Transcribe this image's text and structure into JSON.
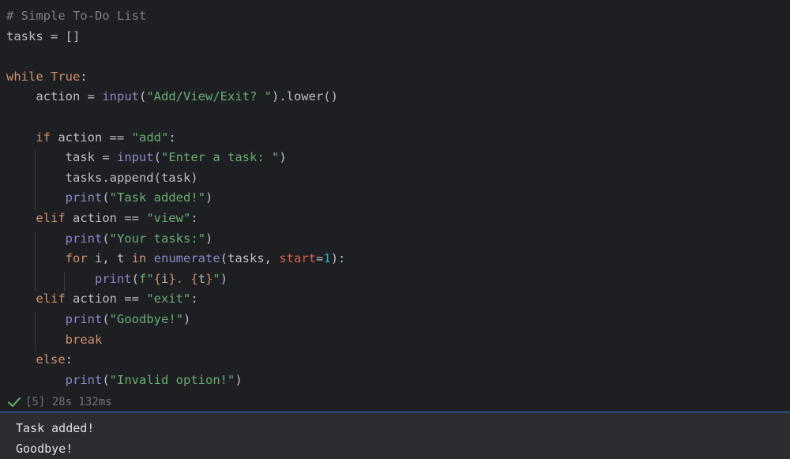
{
  "editor": {
    "lines": [
      [
        {
          "t": "# Simple To-Do List",
          "c": "comment"
        }
      ],
      [
        {
          "t": "tasks = []",
          "c": "plain"
        }
      ],
      [],
      [
        {
          "t": "while",
          "c": "kw"
        },
        {
          "t": " ",
          "c": "plain"
        },
        {
          "t": "True",
          "c": "kw"
        },
        {
          "t": ":",
          "c": "plain"
        }
      ],
      [
        {
          "t": "    action = ",
          "c": "plain"
        },
        {
          "t": "input",
          "c": "builtin"
        },
        {
          "t": "(",
          "c": "plain"
        },
        {
          "t": "\"Add/View/Exit? \"",
          "c": "str"
        },
        {
          "t": ").lower()",
          "c": "plain"
        }
      ],
      [],
      [
        {
          "t": "    ",
          "c": "plain"
        },
        {
          "t": "if",
          "c": "kw"
        },
        {
          "t": " action == ",
          "c": "plain"
        },
        {
          "t": "\"add\"",
          "c": "str"
        },
        {
          "t": ":",
          "c": "plain"
        }
      ],
      [
        {
          "t": "        task = ",
          "c": "plain"
        },
        {
          "t": "input",
          "c": "builtin"
        },
        {
          "t": "(",
          "c": "plain"
        },
        {
          "t": "\"Enter a task: \"",
          "c": "str"
        },
        {
          "t": ")",
          "c": "plain"
        }
      ],
      [
        {
          "t": "        tasks.append(task)",
          "c": "plain"
        }
      ],
      [
        {
          "t": "        ",
          "c": "plain"
        },
        {
          "t": "print",
          "c": "builtin"
        },
        {
          "t": "(",
          "c": "plain"
        },
        {
          "t": "\"Task added!\"",
          "c": "str"
        },
        {
          "t": ")",
          "c": "plain"
        }
      ],
      [
        {
          "t": "    ",
          "c": "plain"
        },
        {
          "t": "elif",
          "c": "kw"
        },
        {
          "t": " action == ",
          "c": "plain"
        },
        {
          "t": "\"view\"",
          "c": "str"
        },
        {
          "t": ":",
          "c": "plain"
        }
      ],
      [
        {
          "t": "        ",
          "c": "plain"
        },
        {
          "t": "print",
          "c": "builtin"
        },
        {
          "t": "(",
          "c": "plain"
        },
        {
          "t": "\"Your tasks:\"",
          "c": "str"
        },
        {
          "t": ")",
          "c": "plain"
        }
      ],
      [
        {
          "t": "        ",
          "c": "plain"
        },
        {
          "t": "for",
          "c": "kw"
        },
        {
          "t": " i, t ",
          "c": "plain"
        },
        {
          "t": "in",
          "c": "kw"
        },
        {
          "t": " ",
          "c": "plain"
        },
        {
          "t": "enumerate",
          "c": "builtin"
        },
        {
          "t": "(tasks, ",
          "c": "plain"
        },
        {
          "t": "start",
          "c": "param"
        },
        {
          "t": "=",
          "c": "plain"
        },
        {
          "t": "1",
          "c": "num"
        },
        {
          "t": "):",
          "c": "plain"
        }
      ],
      [
        {
          "t": "            ",
          "c": "plain"
        },
        {
          "t": "print",
          "c": "builtin"
        },
        {
          "t": "(",
          "c": "plain"
        },
        {
          "t": "f\"",
          "c": "str"
        },
        {
          "t": "{",
          "c": "fbrace"
        },
        {
          "t": "i",
          "c": "plain"
        },
        {
          "t": "}",
          "c": "fbrace"
        },
        {
          "t": ". ",
          "c": "str"
        },
        {
          "t": "{",
          "c": "fbrace"
        },
        {
          "t": "t",
          "c": "plain"
        },
        {
          "t": "}",
          "c": "fbrace"
        },
        {
          "t": "\"",
          "c": "str"
        },
        {
          "t": ")",
          "c": "plain"
        }
      ],
      [
        {
          "t": "    ",
          "c": "plain"
        },
        {
          "t": "elif",
          "c": "kw"
        },
        {
          "t": " action == ",
          "c": "plain"
        },
        {
          "t": "\"exit\"",
          "c": "str"
        },
        {
          "t": ":",
          "c": "plain"
        }
      ],
      [
        {
          "t": "        ",
          "c": "plain"
        },
        {
          "t": "print",
          "c": "builtin"
        },
        {
          "t": "(",
          "c": "plain"
        },
        {
          "t": "\"Goodbye!\"",
          "c": "str"
        },
        {
          "t": ")",
          "c": "plain"
        }
      ],
      [
        {
          "t": "        ",
          "c": "plain"
        },
        {
          "t": "break",
          "c": "kw"
        }
      ],
      [
        {
          "t": "    ",
          "c": "plain"
        },
        {
          "t": "else",
          "c": "kw"
        },
        {
          "t": ":",
          "c": "plain"
        }
      ],
      [
        {
          "t": "        ",
          "c": "plain"
        },
        {
          "t": "print",
          "c": "builtin"
        },
        {
          "t": "(",
          "c": "plain"
        },
        {
          "t": "\"Invalid option!\"",
          "c": "str"
        },
        {
          "t": ")",
          "c": "plain"
        }
      ]
    ]
  },
  "execution": {
    "status_icon": "check-icon",
    "status_color": "#5fb865",
    "label": "[5] 28s 132ms"
  },
  "output": {
    "lines": [
      "Task added!",
      "Goodbye!"
    ]
  },
  "colors": {
    "background": "#1e1f22",
    "output_background": "#2b2d30",
    "accent": "#3574f0"
  }
}
